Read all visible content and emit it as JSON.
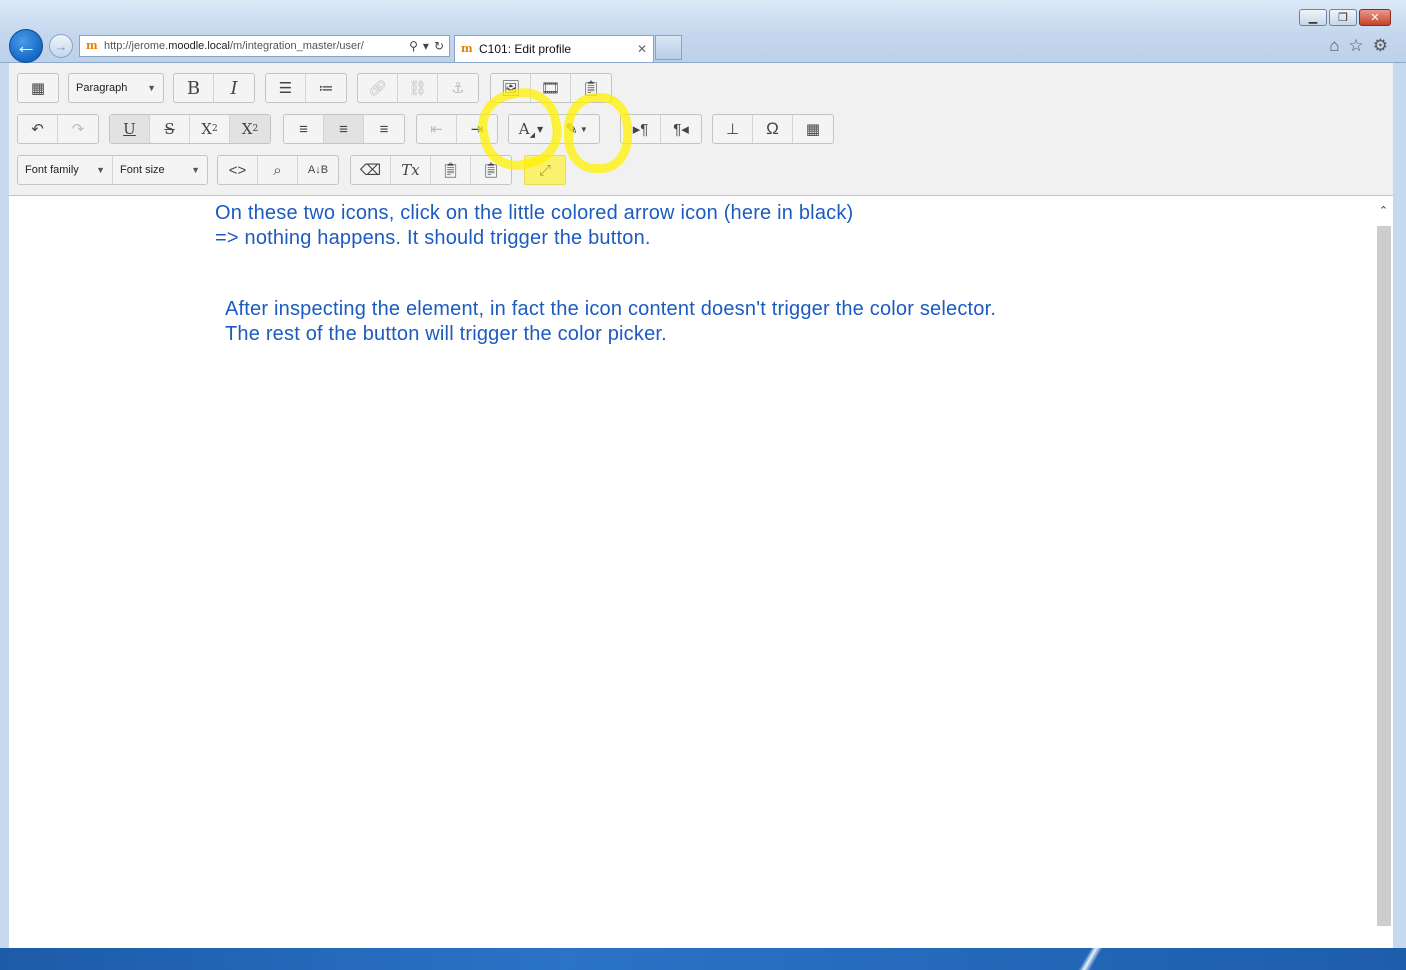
{
  "browser": {
    "url_prefix": "http://jerome.",
    "url_domain": "moodle.local",
    "url_rest": "/m/integration_master/user/",
    "tab_title": "C101: Edit profile",
    "tab_favicon": "m"
  },
  "toolbar": {
    "row1": {
      "paragraph_select": "Paragraph",
      "buttons": [
        "toggle-toolbar-icon",
        "bold-icon",
        "italic-icon",
        "bullet-list-icon",
        "numbered-list-icon",
        "link-icon",
        "unlink-icon",
        "anchor-icon",
        "image-icon",
        "media-icon",
        "manage-files-icon"
      ]
    },
    "row2": {
      "buttons": [
        "undo-icon",
        "redo-icon",
        "underline-icon",
        "strikethrough-icon",
        "subscript-icon",
        "superscript-icon",
        "align-left-icon",
        "align-center-icon",
        "align-right-icon",
        "outdent-icon",
        "indent-icon",
        "text-color-icon",
        "background-color-icon",
        "ltr-icon",
        "rtl-icon",
        "page-break-icon",
        "special-char-icon",
        "table-icon"
      ]
    },
    "row3": {
      "font_family_select": "Font family",
      "font_size_select": "Font size",
      "buttons": [
        "source-code-icon",
        "search-replace-icon",
        "spellcheck-icon",
        "clean-html-icon",
        "clear-formatting-icon",
        "paste-text-icon",
        "paste-word-icon",
        "fullscreen-icon"
      ]
    }
  },
  "editor": {
    "note1_line1": "On these two icons, click on the little colored arrow icon (here in black)",
    "note1_line2": "=> nothing happens. It should trigger the button.",
    "note2_line1": "After inspecting the element, in fact the icon content doesn't trigger the color selector.",
    "note2_line2": "The rest of the button will trigger the color picker.",
    "text_color": "#1c5bc0"
  },
  "highlight_color": "#fff000"
}
